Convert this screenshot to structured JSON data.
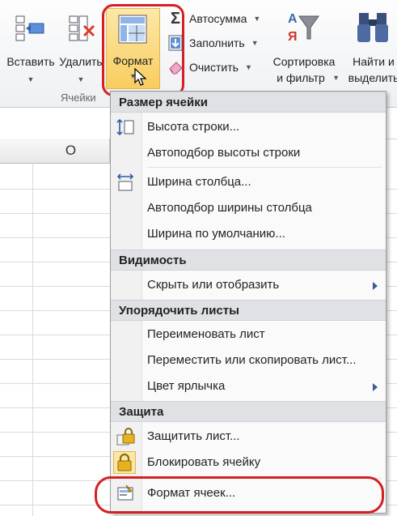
{
  "ribbon": {
    "insert": "Вставить",
    "delete": "Удалить",
    "format": "Формат",
    "group_cells": "Ячейки",
    "autosum": "Автосумма",
    "fill": "Заполнить",
    "clear": "Очистить",
    "sort_line1": "Сортировка",
    "sort_line2": "и фильтр",
    "find_line1": "Найти и",
    "find_line2": "выделить"
  },
  "sheet": {
    "column_o": "O"
  },
  "menu": {
    "sections": {
      "cell_size": "Размер ячейки",
      "visibility": "Видимость",
      "organize": "Упорядочить листы",
      "protection": "Защита"
    },
    "items": {
      "row_height": "Высота строки...",
      "autofit_row": "Автоподбор высоты строки",
      "col_width": "Ширина столбца...",
      "autofit_col": "Автоподбор ширины столбца",
      "default_width": "Ширина по умолчанию...",
      "hide_show": "Скрыть или отобразить",
      "rename": "Переименовать лист",
      "move_copy": "Переместить или скопировать лист...",
      "tab_color": "Цвет ярлычка",
      "protect_sheet": "Защитить лист...",
      "lock_cell": "Блокировать ячейку",
      "format_cells": "Формат ячеек..."
    }
  },
  "colors": {
    "highlight_ring": "#d42024",
    "format_button_bg": "#f8cd5f",
    "section_bg": "#dfe1e5"
  }
}
